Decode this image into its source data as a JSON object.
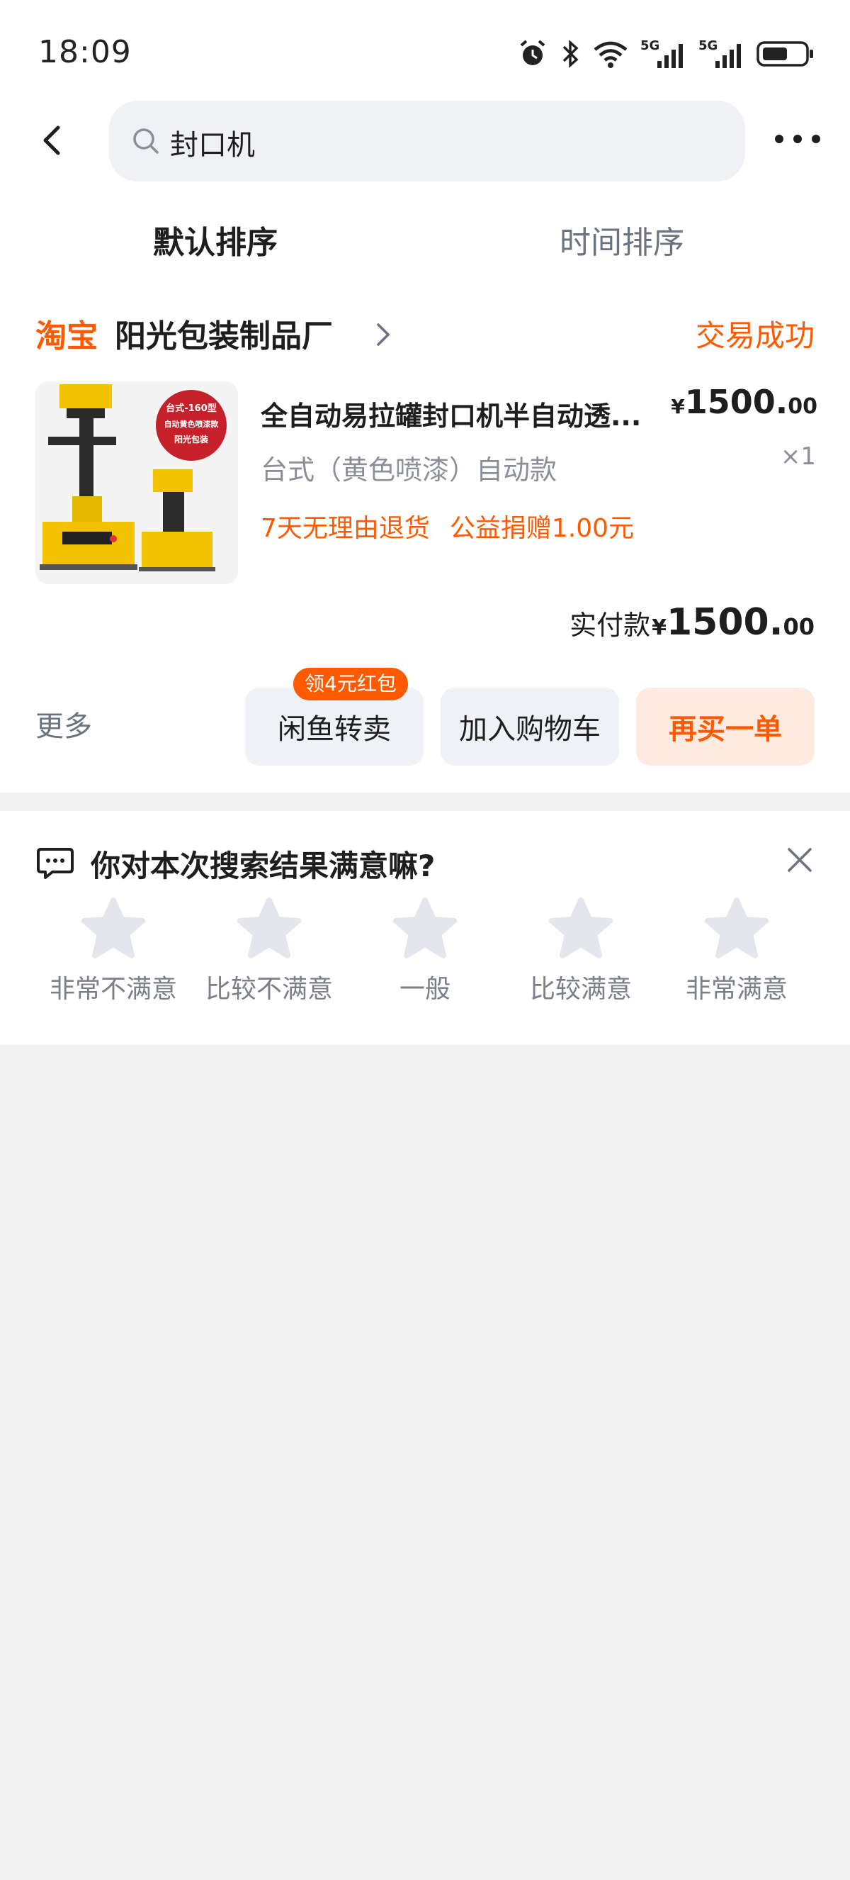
{
  "status_bar": {
    "time": "18:09",
    "network_1": "5G",
    "network_2": "5G"
  },
  "search": {
    "query": "封口机"
  },
  "sort_tabs": [
    {
      "label": "默认排序",
      "active": true
    },
    {
      "label": "时间排序",
      "active": false
    }
  ],
  "order": {
    "shop_badge": "淘宝",
    "shop_name": "阳光包装制品厂",
    "status": "交易成功",
    "product": {
      "title": "全自动易拉罐封口机半自动透...",
      "variant": "台式（黄色喷漆）自动款",
      "price_yen": "¥",
      "price_int": "1500.",
      "price_dec": "00",
      "quantity": "×1",
      "tags": [
        "7天无理由退货",
        "公益捐赠1.00元"
      ],
      "image_label": {
        "line1": "台式-160型",
        "line2": "自动黄色喷漆款",
        "line3": "阳光包装"
      }
    },
    "paid": {
      "label": "实付款",
      "yen": "¥",
      "int": "1500.",
      "dec": "00"
    },
    "actions": {
      "more": "更多",
      "xianyu": "闲鱼转卖",
      "xianyu_badge": "领4元红包",
      "add_cart": "加入购物车",
      "rebuy": "再买一单"
    }
  },
  "survey": {
    "title": "你对本次搜索结果满意嘛?",
    "ratings": [
      "非常不满意",
      "比较不满意",
      "一般",
      "比较满意",
      "非常满意"
    ]
  },
  "colors": {
    "accent": "#ff5a00",
    "muted": "#8a8f98",
    "surface": "#eef1f5",
    "background": "#f2f2f3"
  }
}
